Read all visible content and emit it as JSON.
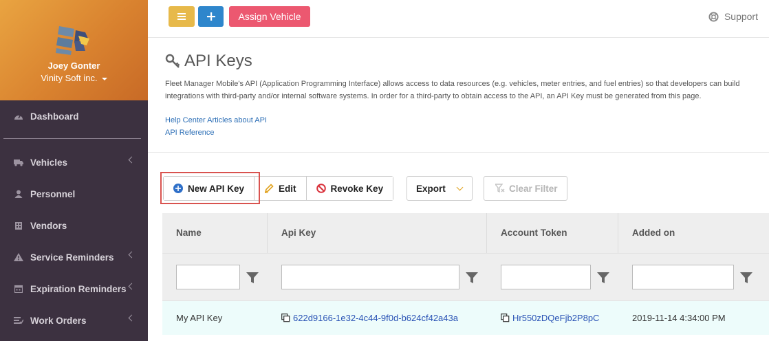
{
  "user": {
    "name": "Joey Gonter",
    "company": "Vinity Soft inc."
  },
  "sidebar": {
    "items": [
      {
        "label": "Dashboard",
        "icon": "dashboard-icon",
        "has_submenu": false
      },
      {
        "label": "Vehicles",
        "icon": "truck-icon",
        "has_submenu": true
      },
      {
        "label": "Personnel",
        "icon": "user-icon",
        "has_submenu": false
      },
      {
        "label": "Vendors",
        "icon": "building-icon",
        "has_submenu": false
      },
      {
        "label": "Service Reminders",
        "icon": "warning-icon",
        "has_submenu": true
      },
      {
        "label": "Expiration Reminders",
        "icon": "calendar-icon",
        "has_submenu": true
      },
      {
        "label": "Work Orders",
        "icon": "list-icon",
        "has_submenu": true
      }
    ]
  },
  "topbar": {
    "assign_label": "Assign Vehicle",
    "support_label": "Support"
  },
  "page": {
    "title": "API Keys",
    "description": "Fleet Manager Mobile's API (Application Programming Interface) allows access to data resources (e.g. vehicles, meter entries, and fuel entries) so that developers can build integrations with third-party and/or internal software systems. In order for a third-party to obtain access to the API, an API Key must be generated from this page.",
    "links": {
      "help": "Help Center Articles about API",
      "reference": "API Reference"
    }
  },
  "toolbar": {
    "new_label": "New API Key",
    "edit_label": "Edit",
    "revoke_label": "Revoke Key",
    "export_label": "Export",
    "clear_label": "Clear Filter"
  },
  "grid": {
    "columns": [
      "Name",
      "Api Key",
      "Account Token",
      "Added on"
    ],
    "rows": [
      {
        "name": "My API Key",
        "api_key": "622d9166-1e32-4c44-9f0d-b624cf42a43a",
        "account_token": "Hr550zDQeFjb2P8pC",
        "added_on": "2019-11-14 4:34:00 PM"
      }
    ]
  },
  "colors": {
    "menu_button": "#e7b94a",
    "add_button": "#2e86cc",
    "assign_button": "#ec5870",
    "sidebar": "#3c3140",
    "highlight": "#d9534f"
  }
}
